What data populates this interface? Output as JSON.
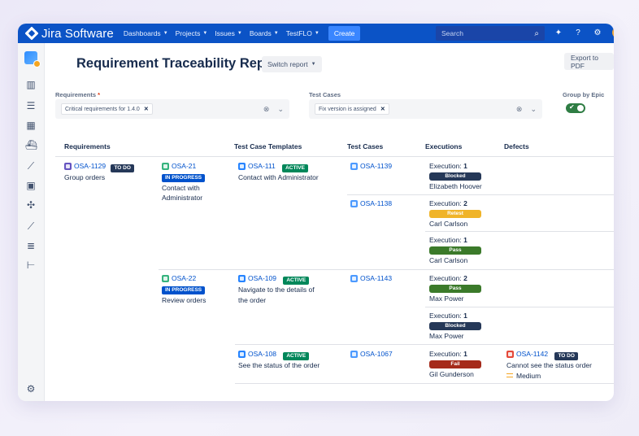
{
  "app": {
    "name": "Jira Software",
    "nav": [
      "Dashboards",
      "Projects",
      "Issues",
      "Boards",
      "TestFLO"
    ],
    "create_label": "Create",
    "search_placeholder": "Search",
    "brand_color": "#0b53c6"
  },
  "header": {
    "title": "Requirement Traceability Report",
    "switch_label": "Switch report",
    "export_label": "Export to PDF"
  },
  "filters": {
    "requirements_label": "Requirements",
    "requirements_chip": "Critical requirements for 1.4.0",
    "testcases_label": "Test Cases",
    "testcases_chip": "Fix version is assigned",
    "group_label": "Group by Epic",
    "group_enabled": true
  },
  "table": {
    "headers": [
      "Requirements",
      "Test Case Templates",
      "Test Cases",
      "Executions",
      "Defects"
    ],
    "epic": {
      "key": "OSA-1129",
      "status": "TO DO",
      "summary": "Group orders"
    },
    "stories": [
      {
        "key": "OSA-21",
        "status": "IN PROGRESS",
        "summary_1": "Contact with",
        "summary_2": "Administrator"
      },
      {
        "key": "OSA-22",
        "status": "IN PROGRESS",
        "summary_1": "Review orders"
      }
    ],
    "templates": [
      {
        "key": "OSA-111",
        "status": "ACTIVE",
        "summary_1": "Contact with Administrator"
      },
      {
        "key": "OSA-109",
        "status": "ACTIVE",
        "summary_1": "Navigate to the details of",
        "summary_2": "the order"
      },
      {
        "key": "OSA-108",
        "status": "ACTIVE",
        "summary_1": "See the status of the order"
      }
    ],
    "test_cases": [
      "OSA-1139",
      "OSA-1138",
      "OSA-1143",
      "OSA-1067"
    ],
    "executions": [
      {
        "label": "Execution:",
        "count": "1",
        "status": "Blocked",
        "color": "#253858",
        "user": "Elizabeth Hoover"
      },
      {
        "label": "Execution:",
        "count": "2",
        "status": "Retest",
        "color": "#f0b429",
        "user": "Carl Carlson"
      },
      {
        "label": "Execution:",
        "count": "1",
        "status": "Pass",
        "color": "#3b7a2a",
        "user": "Carl Carlson"
      },
      {
        "label": "Execution:",
        "count": "2",
        "status": "Pass",
        "color": "#3b7a2a",
        "user": "Max Power"
      },
      {
        "label": "Execution:",
        "count": "1",
        "status": "Blocked",
        "color": "#253858",
        "user": "Max Power"
      },
      {
        "label": "Execution:",
        "count": "1",
        "status": "Fail",
        "color": "#a52a1a",
        "user": "Gil Gunderson"
      }
    ],
    "defect": {
      "key": "OSA-1142",
      "status": "TO DO",
      "summary": "Cannot see the status order",
      "priority": "Medium"
    }
  }
}
